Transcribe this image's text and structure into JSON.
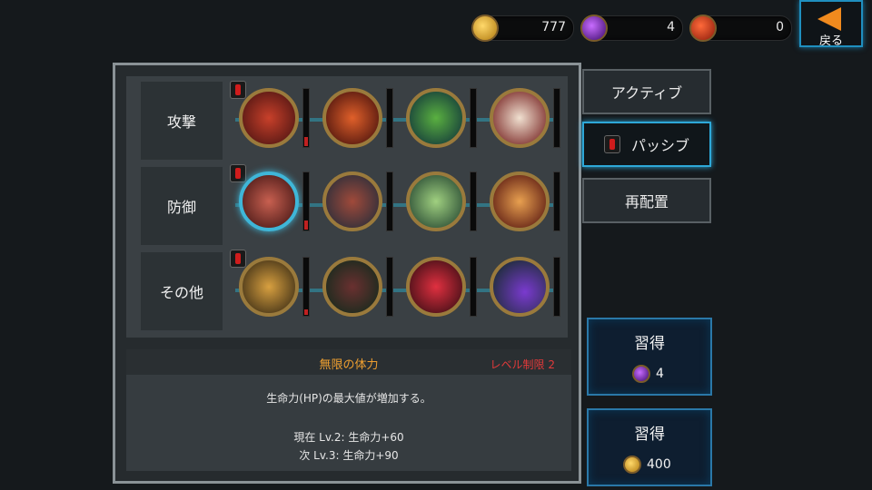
{
  "currency": {
    "gold": {
      "icon": "gold-coin-icon",
      "value": "777"
    },
    "gem": {
      "icon": "purple-gem-icon",
      "value": "4"
    },
    "medal": {
      "icon": "red-medal-icon",
      "value": "0"
    }
  },
  "back": {
    "label": "戻る",
    "icon": "back-arrow-icon"
  },
  "categories": [
    {
      "label": "攻撃",
      "alert": true,
      "skills": [
        "fist-skill-icon",
        "flame-blade-skill-icon",
        "green-slash-skill-icon",
        "teeth-skill-icon"
      ],
      "gauges": [
        0.15,
        0,
        0,
        0
      ]
    },
    {
      "label": "防御",
      "alert": true,
      "skills": [
        "muscle-arm-skill-icon",
        "armor-ball-skill-icon",
        "cross-blades-skill-icon",
        "red-claw-skill-icon"
      ],
      "gauges": [
        0.15,
        0,
        0,
        0
      ]
    },
    {
      "label": "その他",
      "alert": true,
      "skills": [
        "gold-coins-skill-icon",
        "skull-skill-icon",
        "red-orb-skill-icon",
        "purple-orb-skill-icon"
      ],
      "gauges": [
        0.1,
        0,
        0,
        0
      ]
    }
  ],
  "tabs": {
    "active": "アクティブ",
    "passive": "パッシブ",
    "reset": "再配置"
  },
  "detail": {
    "name": "無限の体力",
    "limit": "レベル制限 2",
    "description": "生命力(HP)の最大値が増加する。",
    "current": "現在 Lv.2: 生命力+60",
    "next": "次 Lv.3: 生命力+90"
  },
  "learn_gem": {
    "label": "習得",
    "cost": "4",
    "icon": "purple-gem-icon"
  },
  "learn_gold": {
    "label": "習得",
    "cost": "400",
    "icon": "gold-coin-icon"
  },
  "colors": {
    "accent": "#2ea8d8",
    "gold": "#f0a030",
    "alert": "#d01c1c"
  }
}
